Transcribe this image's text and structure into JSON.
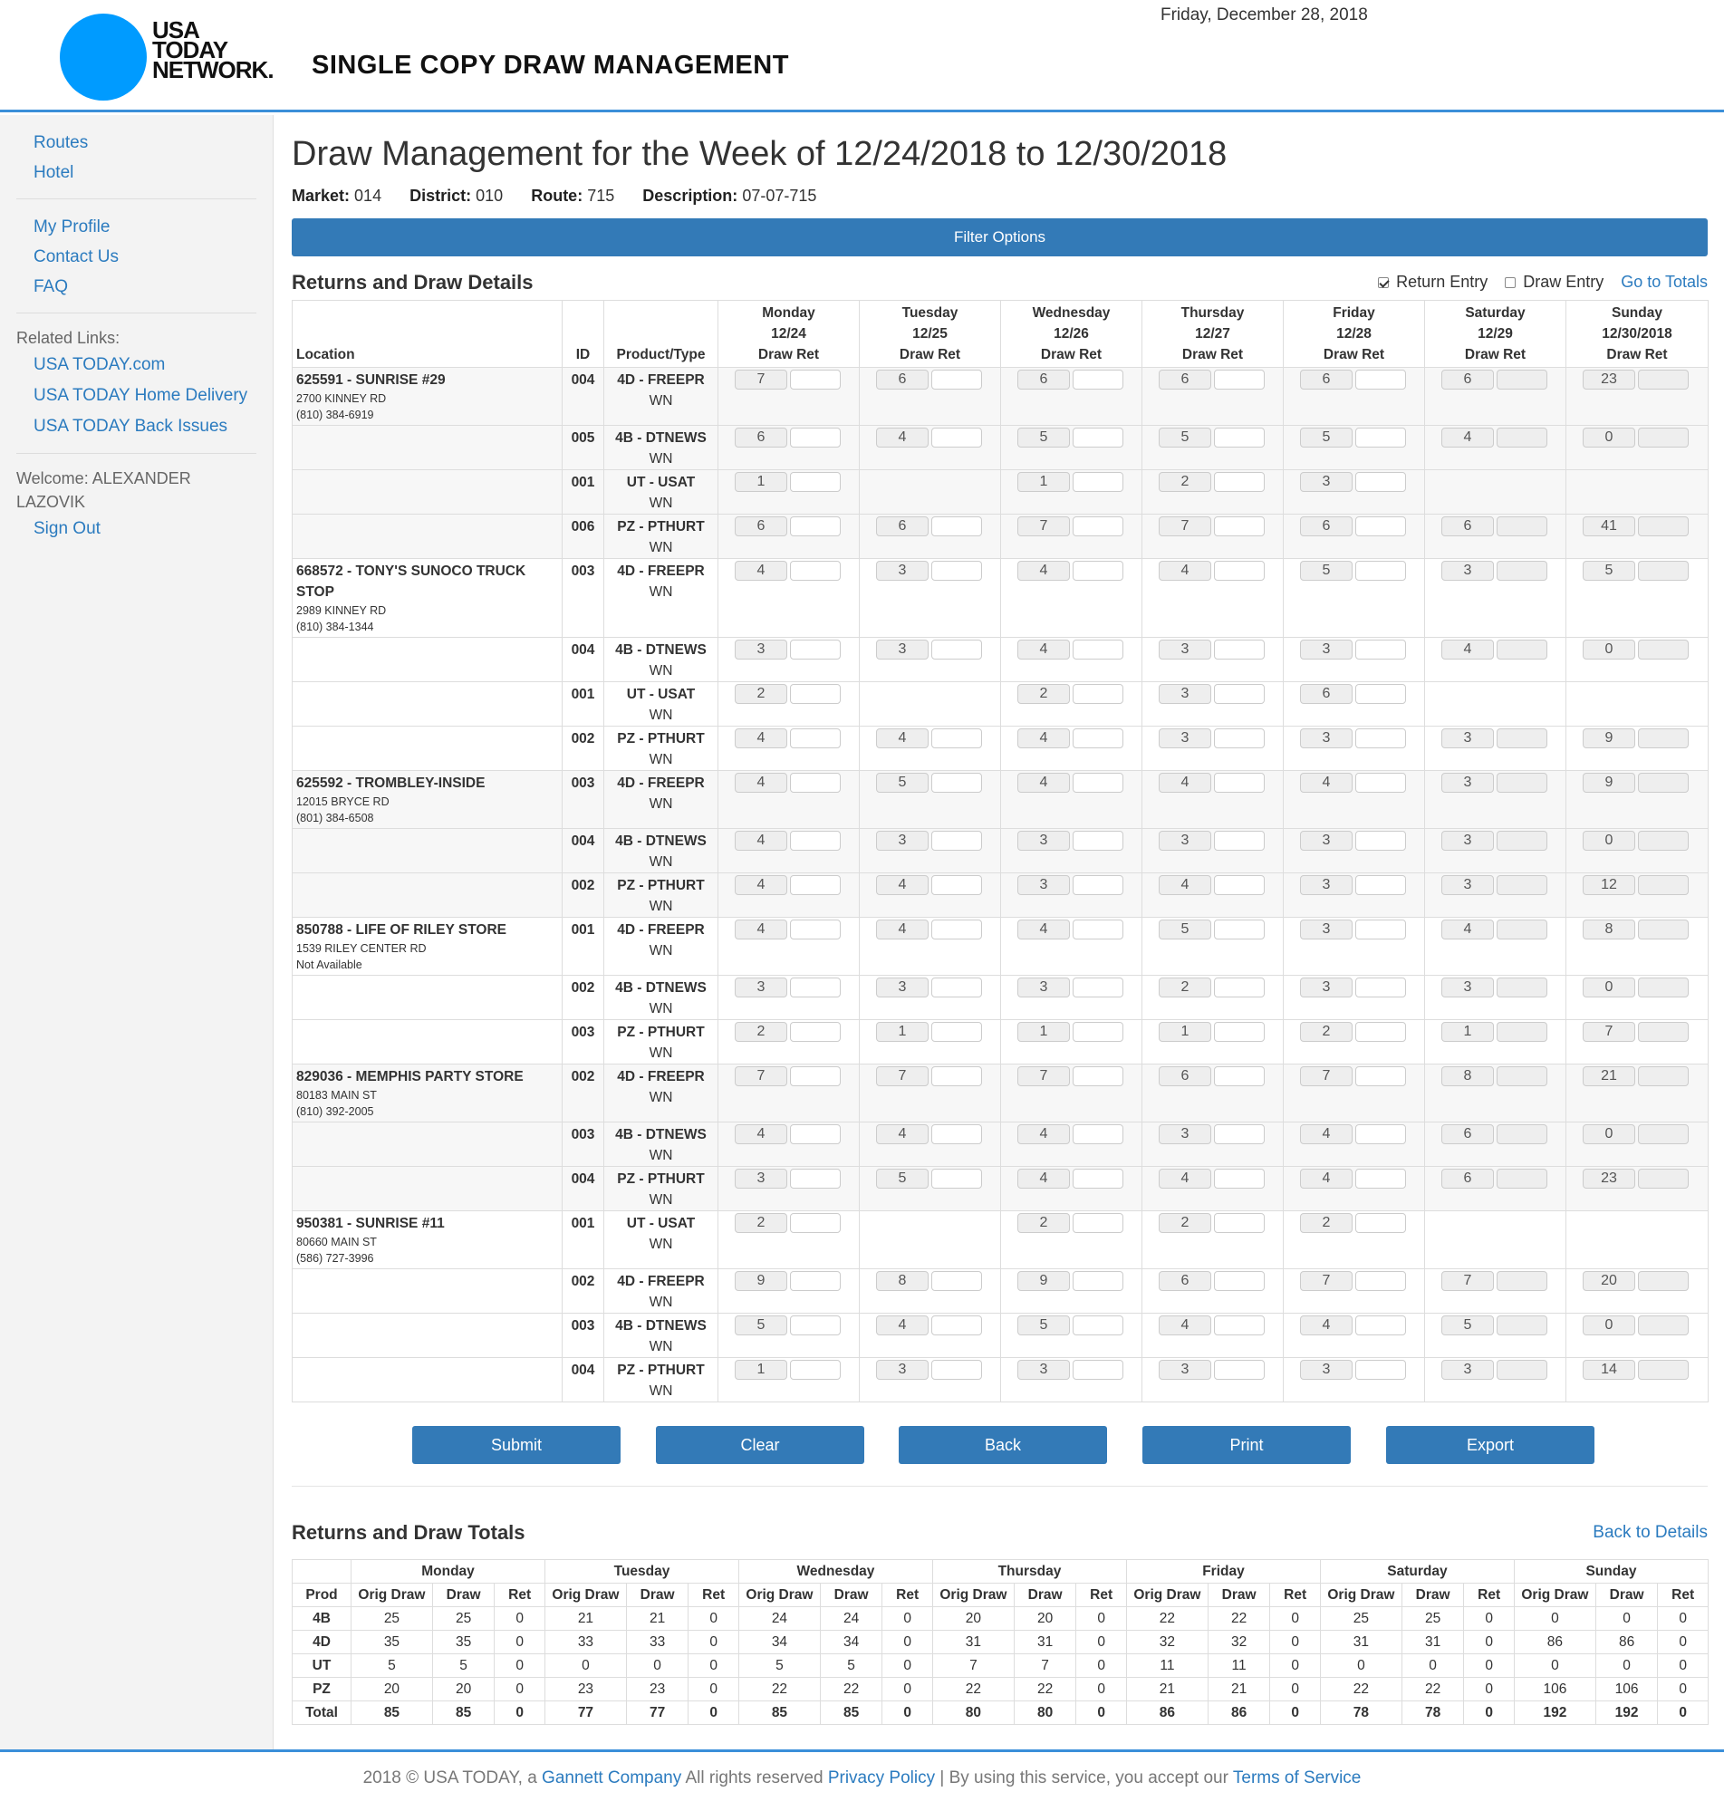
{
  "header": {
    "logo_lines": [
      "USA",
      "TODAY",
      "NETWORK."
    ],
    "app_title": "SINGLE COPY DRAW MANAGEMENT",
    "date": "Friday, December 28, 2018"
  },
  "sidebar": {
    "nav1": [
      "Routes",
      "Hotel"
    ],
    "nav2": [
      "My Profile",
      "Contact Us",
      "FAQ"
    ],
    "related_label": "Related Links:",
    "related": [
      "USA TODAY.com",
      "USA TODAY Home Delivery",
      "USA TODAY Back Issues"
    ],
    "welcome": "Welcome: ALEXANDER LAZOVIK",
    "sign_out": "Sign Out"
  },
  "main": {
    "page_title": "Draw Management for the Week of 12/24/2018 to 12/30/2018",
    "meta": {
      "market_label": "Market:",
      "market": "014",
      "district_label": "District:",
      "district": "010",
      "route_label": "Route:",
      "route": "715",
      "desc_label": "Description:",
      "desc": "07-07-715"
    },
    "filter_label": "Filter Options",
    "details_title": "Returns and Draw Details",
    "return_entry": "Return Entry",
    "draw_entry": "Draw Entry",
    "go_to_totals": "Go to Totals",
    "columns": {
      "location": "Location",
      "id": "ID",
      "product": "Product/Type",
      "draw_ret": "Draw Ret",
      "days": [
        {
          "name": "Monday",
          "date": "12/24"
        },
        {
          "name": "Tuesday",
          "date": "12/25"
        },
        {
          "name": "Wednesday",
          "date": "12/26"
        },
        {
          "name": "Thursday",
          "date": "12/27"
        },
        {
          "name": "Friday",
          "date": "12/28"
        },
        {
          "name": "Saturday",
          "date": "12/29"
        },
        {
          "name": "Sunday",
          "date": "12/30/2018"
        }
      ]
    },
    "rows": [
      {
        "loc": {
          "name": "625591 - SUNRISE #29",
          "addr": "2700 KINNEY RD",
          "phone": "(810) 384-6919"
        },
        "id": "004",
        "prod": "4D - FREEPR",
        "type": "WN",
        "draws": [
          "7",
          "6",
          "6",
          "6",
          "6",
          "6",
          "23"
        ]
      },
      {
        "id": "005",
        "prod": "4B - DTNEWS",
        "type": "WN",
        "draws": [
          "6",
          "4",
          "5",
          "5",
          "5",
          "4",
          "0"
        ]
      },
      {
        "id": "001",
        "prod": "UT - USAT",
        "type": "WN",
        "draws": [
          "1",
          null,
          "1",
          "2",
          "3",
          null,
          null
        ]
      },
      {
        "id": "006",
        "prod": "PZ - PTHURT",
        "type": "WN",
        "draws": [
          "6",
          "6",
          "7",
          "7",
          "6",
          "6",
          "41"
        ]
      },
      {
        "loc": {
          "name": "668572 - TONY'S SUNOCO TRUCK STOP",
          "addr": "2989 KINNEY RD",
          "phone": "(810) 384-1344"
        },
        "id": "003",
        "prod": "4D - FREEPR",
        "type": "WN",
        "draws": [
          "4",
          "3",
          "4",
          "4",
          "5",
          "3",
          "5"
        ]
      },
      {
        "id": "004",
        "prod": "4B - DTNEWS",
        "type": "WN",
        "draws": [
          "3",
          "3",
          "4",
          "3",
          "3",
          "4",
          "0"
        ]
      },
      {
        "id": "001",
        "prod": "UT - USAT",
        "type": "WN",
        "draws": [
          "2",
          null,
          "2",
          "3",
          "6",
          null,
          null
        ]
      },
      {
        "id": "002",
        "prod": "PZ - PTHURT",
        "type": "WN",
        "draws": [
          "4",
          "4",
          "4",
          "3",
          "3",
          "3",
          "9"
        ]
      },
      {
        "loc": {
          "name": "625592 - TROMBLEY-INSIDE",
          "addr": "12015 BRYCE RD",
          "phone": "(801) 384-6508"
        },
        "id": "003",
        "prod": "4D - FREEPR",
        "type": "WN",
        "draws": [
          "4",
          "5",
          "4",
          "4",
          "4",
          "3",
          "9"
        ]
      },
      {
        "id": "004",
        "prod": "4B - DTNEWS",
        "type": "WN",
        "draws": [
          "4",
          "3",
          "3",
          "3",
          "3",
          "3",
          "0"
        ]
      },
      {
        "id": "002",
        "prod": "PZ - PTHURT",
        "type": "WN",
        "draws": [
          "4",
          "4",
          "3",
          "4",
          "3",
          "3",
          "12"
        ]
      },
      {
        "loc": {
          "name": "850788 - LIFE OF RILEY STORE",
          "addr": "1539 RILEY CENTER RD",
          "phone": "Not Available"
        },
        "id": "001",
        "prod": "4D - FREEPR",
        "type": "WN",
        "draws": [
          "4",
          "4",
          "4",
          "5",
          "3",
          "4",
          "8"
        ]
      },
      {
        "id": "002",
        "prod": "4B - DTNEWS",
        "type": "WN",
        "draws": [
          "3",
          "3",
          "3",
          "2",
          "3",
          "3",
          "0"
        ]
      },
      {
        "id": "003",
        "prod": "PZ - PTHURT",
        "type": "WN",
        "draws": [
          "2",
          "1",
          "1",
          "1",
          "2",
          "1",
          "7"
        ]
      },
      {
        "loc": {
          "name": "829036 - MEMPHIS PARTY STORE",
          "addr": "80183 MAIN ST",
          "phone": "(810) 392-2005"
        },
        "id": "002",
        "prod": "4D - FREEPR",
        "type": "WN",
        "draws": [
          "7",
          "7",
          "7",
          "6",
          "7",
          "8",
          "21"
        ]
      },
      {
        "id": "003",
        "prod": "4B - DTNEWS",
        "type": "WN",
        "draws": [
          "4",
          "4",
          "4",
          "3",
          "4",
          "6",
          "0"
        ]
      },
      {
        "id": "004",
        "prod": "PZ - PTHURT",
        "type": "WN",
        "draws": [
          "3",
          "5",
          "4",
          "4",
          "4",
          "6",
          "23"
        ]
      },
      {
        "loc": {
          "name": "950381 - SUNRISE #11",
          "addr": "80660 MAIN ST",
          "phone": "(586) 727-3996"
        },
        "id": "001",
        "prod": "UT - USAT",
        "type": "WN",
        "draws": [
          "2",
          null,
          "2",
          "2",
          "2",
          null,
          null
        ]
      },
      {
        "id": "002",
        "prod": "4D - FREEPR",
        "type": "WN",
        "draws": [
          "9",
          "8",
          "9",
          "6",
          "7",
          "7",
          "20"
        ]
      },
      {
        "id": "003",
        "prod": "4B - DTNEWS",
        "type": "WN",
        "draws": [
          "5",
          "4",
          "5",
          "4",
          "4",
          "5",
          "0"
        ]
      },
      {
        "id": "004",
        "prod": "PZ - PTHURT",
        "type": "WN",
        "draws": [
          "1",
          "3",
          "3",
          "3",
          "3",
          "3",
          "14"
        ]
      }
    ],
    "buttons": [
      "Submit",
      "Clear",
      "Back",
      "Print",
      "Export"
    ],
    "totals_title": "Returns and Draw Totals",
    "back_to_details": "Back to Details",
    "totals": {
      "days": [
        "Monday",
        "Tuesday",
        "Wednesday",
        "Thursday",
        "Friday",
        "Saturday",
        "Sunday"
      ],
      "prod_header": "Prod",
      "sub_headers": [
        "Orig Draw",
        "Draw",
        "Ret"
      ],
      "rows": [
        {
          "prod": "4B",
          "vals": [
            "25",
            "25",
            "0",
            "21",
            "21",
            "0",
            "24",
            "24",
            "0",
            "20",
            "20",
            "0",
            "22",
            "22",
            "0",
            "25",
            "25",
            "0",
            "0",
            "0",
            "0"
          ]
        },
        {
          "prod": "4D",
          "vals": [
            "35",
            "35",
            "0",
            "33",
            "33",
            "0",
            "34",
            "34",
            "0",
            "31",
            "31",
            "0",
            "32",
            "32",
            "0",
            "31",
            "31",
            "0",
            "86",
            "86",
            "0"
          ]
        },
        {
          "prod": "UT",
          "vals": [
            "5",
            "5",
            "0",
            "0",
            "0",
            "0",
            "5",
            "5",
            "0",
            "7",
            "7",
            "0",
            "11",
            "11",
            "0",
            "0",
            "0",
            "0",
            "0",
            "0",
            "0"
          ]
        },
        {
          "prod": "PZ",
          "vals": [
            "20",
            "20",
            "0",
            "23",
            "23",
            "0",
            "22",
            "22",
            "0",
            "22",
            "22",
            "0",
            "21",
            "21",
            "0",
            "22",
            "22",
            "0",
            "106",
            "106",
            "0"
          ]
        },
        {
          "prod": "Total",
          "vals": [
            "85",
            "85",
            "0",
            "77",
            "77",
            "0",
            "85",
            "85",
            "0",
            "80",
            "80",
            "0",
            "86",
            "86",
            "0",
            "78",
            "78",
            "0",
            "192",
            "192",
            "0"
          ]
        }
      ]
    }
  },
  "footer": {
    "prefix": "2018 © USA TODAY, a ",
    "gannett": "Gannett Company",
    "mid": " All rights reserved ",
    "privacy": "Privacy Policy",
    "mid2": " | By using this service, you accept our ",
    "terms": "Terms of Service"
  },
  "colors": {
    "accent": "#337ab7",
    "link": "#2b7bbf",
    "logo": "#009bff",
    "rule": "#3b8fd9"
  }
}
